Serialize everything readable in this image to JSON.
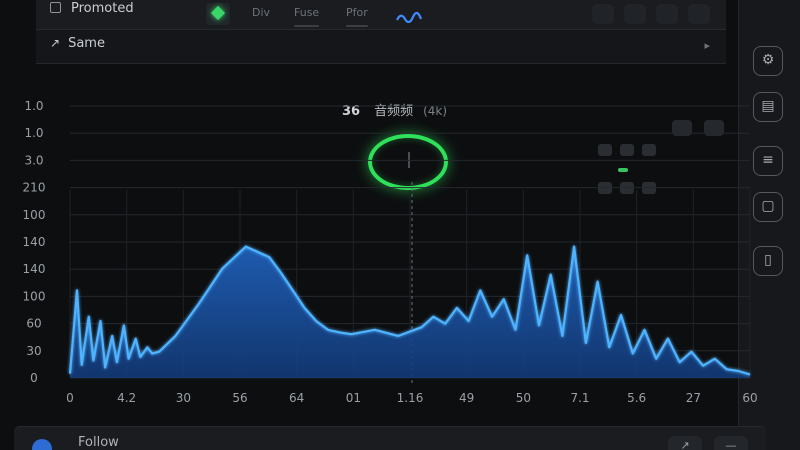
{
  "toolbar": {
    "title": "Promoted",
    "tabs": [
      "Div",
      "Fuse",
      "Pfor"
    ]
  },
  "subbar": {
    "label": "Same"
  },
  "header": {
    "value": "36",
    "label": "音频频",
    "unit": "(4k)"
  },
  "bottombar": {
    "label": "Follow"
  },
  "colors": {
    "accent_green": "#2ee05a",
    "series_blue": "#4fb3ff",
    "fill_blue": "#1f5fb8",
    "background": "#0d0e10"
  },
  "icons": [
    "checkbox-icon",
    "diamond-icon",
    "waveform-icon",
    "pen-icon",
    "chevron-icon",
    "gear-icon",
    "layers-icon"
  ],
  "chart_data": {
    "type": "area",
    "title": "",
    "xlabel": "",
    "ylabel": "",
    "y_tick_labels": [
      "0",
      "30",
      "60",
      "100",
      "140",
      "140",
      "100",
      "210",
      "3.0",
      "1.0",
      "1.0"
    ],
    "x_tick_labels": [
      "0",
      "4.2",
      "30",
      "56",
      "64",
      "01",
      "1.16",
      "49",
      "50",
      "7.1",
      "5.6",
      "27",
      "60"
    ],
    "ylim": [
      0,
      210
    ],
    "grid": true,
    "legend": "none",
    "series": [
      {
        "x": [
          0,
          0.3,
          0.5,
          0.8,
          1,
          1.3,
          1.5,
          1.8,
          2,
          2.3,
          2.5,
          2.8,
          3,
          3.3,
          3.5,
          3.8,
          4.5,
          5.5,
          6.5,
          7.5,
          8.5,
          9,
          9.5,
          10,
          10.5,
          11,
          11.5,
          12,
          13,
          14,
          15,
          15.5,
          16,
          16.5,
          17,
          17.5,
          18,
          18.5,
          19,
          19.5,
          20,
          20.5,
          21,
          21.5,
          22,
          22.5,
          23,
          23.5,
          24,
          24.5,
          25,
          25.5,
          26,
          26.5,
          27,
          27.5,
          28,
          28.5,
          29
        ],
        "values": [
          5,
          100,
          15,
          70,
          20,
          65,
          12,
          48,
          18,
          60,
          22,
          45,
          24,
          35,
          28,
          30,
          48,
          85,
          125,
          150,
          138,
          120,
          100,
          80,
          65,
          55,
          52,
          50,
          55,
          48,
          58,
          70,
          62,
          80,
          65,
          100,
          70,
          90,
          55,
          140,
          60,
          118,
          48,
          150,
          40,
          110,
          35,
          72,
          28,
          55,
          22,
          45,
          18,
          30,
          14,
          22,
          10,
          8,
          4
        ]
      }
    ]
  }
}
